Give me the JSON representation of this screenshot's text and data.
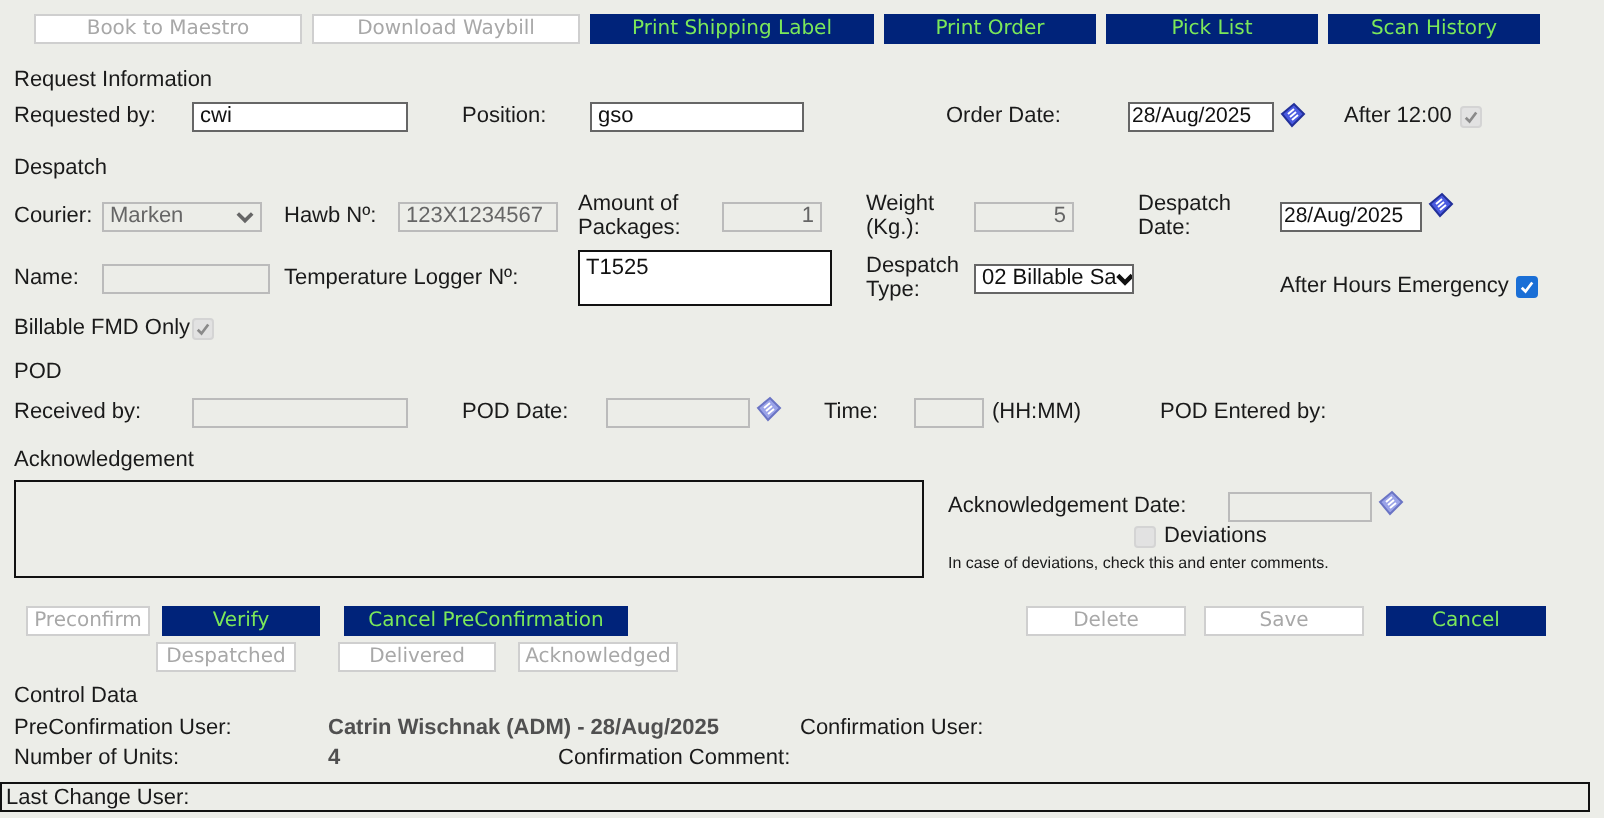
{
  "toolbar": [
    {
      "label": "Book to Maestro",
      "disabled": true
    },
    {
      "label": "Download Waybill",
      "disabled": true
    },
    {
      "label": "Print Shipping Label",
      "disabled": false
    },
    {
      "label": "Print Order",
      "disabled": false
    },
    {
      "label": "Pick List",
      "disabled": false
    },
    {
      "label": "Scan History",
      "disabled": false
    }
  ],
  "request": {
    "title": "Request Information",
    "requested_by": {
      "label": "Requested by:",
      "value": "cwi",
      "disabled": false
    },
    "position": {
      "label": "Position:",
      "value": "gso",
      "disabled": false
    },
    "order_date": {
      "label": "Order Date:",
      "value": "28/Aug/2025",
      "disabled": false
    },
    "after_noon": {
      "label": "After 12:00",
      "checked": true,
      "disabled": true
    }
  },
  "despatch": {
    "title": "Despatch",
    "courier": {
      "label": "Courier:",
      "value": "Marken",
      "disabled": true
    },
    "hawb": {
      "label": "Hawb Nº:",
      "value": "123X1234567",
      "disabled": true
    },
    "packages": {
      "label": "Amount of Packages:",
      "value": "1",
      "disabled": true
    },
    "weight": {
      "label": "Weight (Kg.):",
      "value": "5",
      "disabled": true
    },
    "despatch_date": {
      "label": "Despatch Date:",
      "value": "28/Aug/2025",
      "disabled": false
    },
    "name": {
      "label": "Name:",
      "disabled": true
    },
    "temperature_logger": {
      "label": "Temperature Logger Nº:",
      "value": "T1525",
      "disabled": false
    },
    "despatch_type": {
      "label": "Despatch Type:",
      "value": "02 Billable Sa",
      "disabled": false
    },
    "after_hours_emergency": {
      "label": "After Hours Emergency",
      "checked": true,
      "disabled": false
    },
    "billable_fmd_only": {
      "label": "Billable FMD Only",
      "checked": true,
      "disabled": true
    }
  },
  "pod": {
    "title": "POD",
    "received_by": {
      "label": "Received by:",
      "disabled": true
    },
    "pod_date": {
      "label": "POD Date:",
      "disabled": true
    },
    "time": {
      "label": "Time:",
      "hint": "(HH:MM)",
      "disabled": true
    },
    "entered_by": {
      "label": "POD Entered by:"
    }
  },
  "acknowledgement": {
    "title": "Acknowledgement",
    "date": {
      "label": "Acknowledgement Date:",
      "disabled": true
    },
    "deviations": {
      "label": "Deviations",
      "checked": false,
      "disabled": true
    },
    "note": "In case of deviations, check this and enter comments."
  },
  "actions": [
    {
      "label": "Preconfirm",
      "disabled": true
    },
    {
      "label": "Verify",
      "disabled": false
    },
    {
      "label": "Cancel PreConfirmation",
      "disabled": false
    },
    {
      "label": "Delete",
      "disabled": true
    },
    {
      "label": "Save",
      "disabled": true
    },
    {
      "label": "Cancel",
      "disabled": false
    }
  ],
  "status_buttons": [
    {
      "label": "Despatched",
      "disabled": true
    },
    {
      "label": "Delivered",
      "disabled": true
    },
    {
      "label": "Acknowledged",
      "disabled": true
    }
  ],
  "control_data": {
    "title": "Control Data",
    "preconfirmation_user": {
      "label": "PreConfirmation User:",
      "value": "Catrin Wischnak (ADM) - 28/Aug/2025"
    },
    "confirmation_user": {
      "label": "Confirmation User:"
    },
    "units": {
      "label": "Number of Units:",
      "value": "4"
    },
    "confirmation_comment": {
      "label": "Confirmation Comment:"
    },
    "last_change_user": {
      "label": "Last Change User:"
    }
  }
}
